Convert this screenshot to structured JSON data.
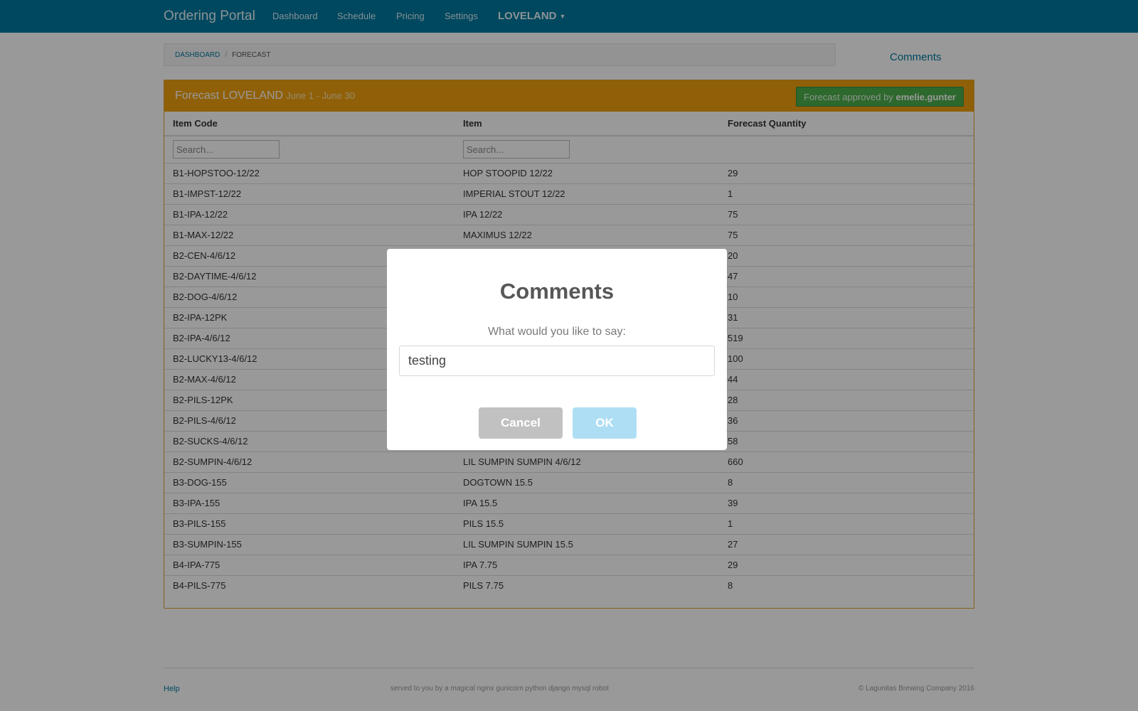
{
  "navbar": {
    "brand": "Ordering Portal",
    "links": [
      "Dashboard",
      "Schedule",
      "Pricing",
      "Settings"
    ],
    "location": "LOVELAND",
    "accent": "#00789f"
  },
  "breadcrumb": {
    "home": "DASHBOARD",
    "separator": "/",
    "current": "FORECAST"
  },
  "comments_link": "Comments",
  "panel": {
    "title": "Forecast LOVELAND",
    "subtitle": "June 1 - June 30",
    "approved_prefix": "Forecast approved by",
    "approved_user": "emelie.gunter",
    "color": "#f0a010"
  },
  "table": {
    "headers": [
      "Item Code",
      "Item",
      "Forecast Quantity"
    ],
    "search_placeholder": "Search...",
    "rows": [
      [
        "B1-HOPSTOO-12/22",
        "HOP STOOPID 12/22",
        "29"
      ],
      [
        "B1-IMPST-12/22",
        "IMPERIAL STOUT 12/22",
        "1"
      ],
      [
        "B1-IPA-12/22",
        "IPA 12/22",
        "75"
      ],
      [
        "B1-MAX-12/22",
        "MAXIMUS 12/22",
        "75"
      ],
      [
        "B2-CEN-4/6/12",
        "",
        "20"
      ],
      [
        "B2-DAYTIME-4/6/12",
        "",
        "47"
      ],
      [
        "B2-DOG-4/6/12",
        "",
        "10"
      ],
      [
        "B2-IPA-12PK",
        "",
        "31"
      ],
      [
        "B2-IPA-4/6/12",
        "",
        "519"
      ],
      [
        "B2-LUCKY13-4/6/12",
        "",
        "100"
      ],
      [
        "B2-MAX-4/6/12",
        "",
        "44"
      ],
      [
        "B2-PILS-12PK",
        "",
        "28"
      ],
      [
        "B2-PILS-4/6/12",
        "",
        "36"
      ],
      [
        "B2-SUCKS-4/6/12",
        "",
        "58"
      ],
      [
        "B2-SUMPIN-4/6/12",
        "LIL SUMPIN SUMPIN 4/6/12",
        "660"
      ],
      [
        "B3-DOG-155",
        "DOGTOWN 15.5",
        "8"
      ],
      [
        "B3-IPA-155",
        "IPA 15.5",
        "39"
      ],
      [
        "B3-PILS-155",
        "PILS 15.5",
        "1"
      ],
      [
        "B3-SUMPIN-155",
        "LIL SUMPIN SUMPIN 15.5",
        "27"
      ],
      [
        "B4-IPA-775",
        "IPA 7.75",
        "29"
      ],
      [
        "B4-PILS-775",
        "PILS 7.75",
        "8"
      ]
    ]
  },
  "footer": {
    "help": "Help",
    "middle": "served to you by a magical nginx gunicorn python django mysql robot",
    "right": "© Lagunitas Brewing Company 2016"
  },
  "modal": {
    "title": "Comments",
    "prompt": "What would you like to say:",
    "input_value": "testing",
    "cancel": "Cancel",
    "ok": "OK"
  }
}
